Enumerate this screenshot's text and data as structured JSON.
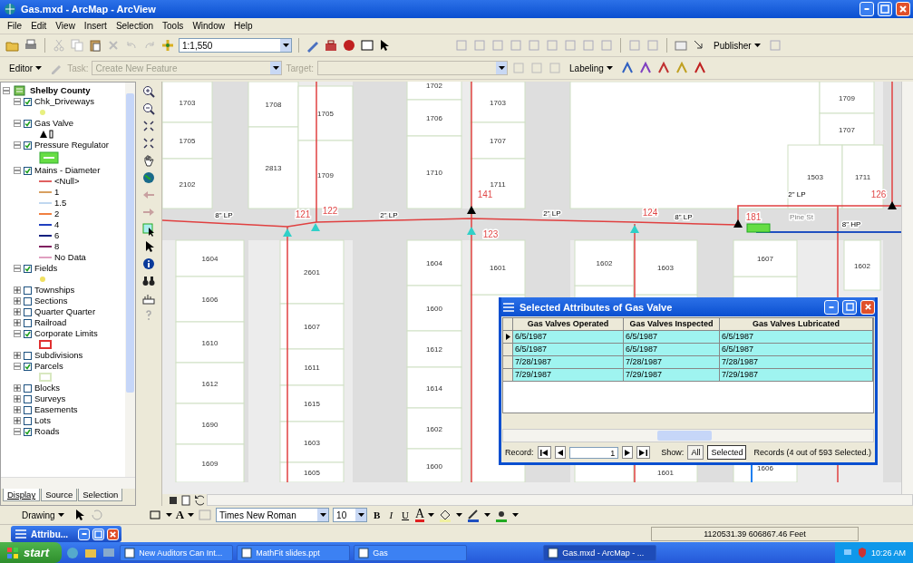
{
  "window": {
    "title": "Gas.mxd - ArcMap - ArcView"
  },
  "menu": [
    "File",
    "Edit",
    "View",
    "Insert",
    "Selection",
    "Tools",
    "Window",
    "Help"
  ],
  "standard_toolbar": {
    "scale": "1:1,550",
    "publisher": "Publisher"
  },
  "editor_toolbar": {
    "editor": "Editor",
    "task_label": "Task:",
    "task": "Create New Feature",
    "target_label": "Target:",
    "labeling": "Labeling"
  },
  "toc": {
    "root": "Shelby County",
    "root_expanded": true,
    "layers": [
      {
        "name": "Chk_Driveways",
        "checked": true,
        "expanded": true,
        "legend": [
          {
            "kind": "point",
            "color": "#e8f080"
          }
        ]
      },
      {
        "name": "Gas Valve",
        "checked": true,
        "expanded": true,
        "legend": [
          {
            "kind": "triangle",
            "color": "#000000"
          }
        ]
      },
      {
        "name": "Pressure Regulator",
        "checked": true,
        "expanded": true,
        "legend": [
          {
            "kind": "fill",
            "color": "#66dd44"
          }
        ]
      },
      {
        "name": "Mains - Diameter",
        "checked": true,
        "expanded": true,
        "legend": [
          {
            "kind": "line",
            "label": "<Null>",
            "color": "#e06060"
          },
          {
            "kind": "line",
            "label": "1",
            "color": "#d8a060"
          },
          {
            "kind": "line",
            "label": "1.5",
            "color": "#c0d8f0"
          },
          {
            "kind": "line",
            "label": "2",
            "color": "#f08040"
          },
          {
            "kind": "line",
            "label": "4",
            "color": "#2040c0"
          },
          {
            "kind": "line",
            "label": "6",
            "color": "#102080"
          },
          {
            "kind": "line",
            "label": "8",
            "color": "#802060"
          },
          {
            "kind": "line",
            "label": "No Data",
            "color": "#e0a0c0"
          }
        ]
      },
      {
        "name": "Fields",
        "checked": true,
        "expanded": true,
        "legend": [
          {
            "kind": "point",
            "color": "#f0e060"
          }
        ]
      },
      {
        "name": "Townships",
        "checked": false,
        "expanded": false
      },
      {
        "name": "Sections",
        "checked": false,
        "expanded": false
      },
      {
        "name": "Quarter Quarter",
        "checked": false,
        "expanded": false
      },
      {
        "name": "Railroad",
        "checked": false,
        "expanded": false
      },
      {
        "name": "Corporate Limits",
        "checked": true,
        "expanded": true,
        "legend": [
          {
            "kind": "outline",
            "color": "#e03030"
          }
        ]
      },
      {
        "name": "Subdivisions",
        "checked": false,
        "expanded": false
      },
      {
        "name": "Parcels",
        "checked": true,
        "expanded": true,
        "legend": [
          {
            "kind": "outline",
            "color": "#d8e8c0"
          }
        ]
      },
      {
        "name": "Blocks",
        "checked": false,
        "expanded": false
      },
      {
        "name": "Surveys",
        "checked": false,
        "expanded": false
      },
      {
        "name": "Easements",
        "checked": false,
        "expanded": false
      },
      {
        "name": "Lots",
        "checked": false,
        "expanded": false
      },
      {
        "name": "Roads",
        "checked": true,
        "expanded": true
      }
    ]
  },
  "toc_tabs": [
    {
      "label": "Display",
      "selected": true
    },
    {
      "label": "Source",
      "selected": false
    },
    {
      "label": "Selection",
      "selected": false
    }
  ],
  "map": {
    "parcels": [
      {
        "label": "1703"
      },
      {
        "label": "1705"
      },
      {
        "label": "2102"
      },
      {
        "label": "1708"
      },
      {
        "label": "2813"
      },
      {
        "label": "1705"
      },
      {
        "label": "1709"
      },
      {
        "label": "1702"
      },
      {
        "label": "1706"
      },
      {
        "label": "1710"
      },
      {
        "label": "1703"
      },
      {
        "label": "1707"
      },
      {
        "label": "1711"
      },
      {
        "label": "1709"
      },
      {
        "label": "1707"
      },
      {
        "label": "1503"
      },
      {
        "label": "1711"
      },
      {
        "label": "1604"
      },
      {
        "label": "1606"
      },
      {
        "label": "1610"
      },
      {
        "label": "1612"
      },
      {
        "label": "1690"
      },
      {
        "label": "1609"
      },
      {
        "label": "2601"
      },
      {
        "label": "1607"
      },
      {
        "label": "1611"
      },
      {
        "label": "1615"
      },
      {
        "label": "1603"
      },
      {
        "label": "1605"
      },
      {
        "label": "1604"
      },
      {
        "label": "1600"
      },
      {
        "label": "1612"
      },
      {
        "label": "1614"
      },
      {
        "label": "1602"
      },
      {
        "label": "1600"
      },
      {
        "label": "1601"
      },
      {
        "label": "1602"
      },
      {
        "label": "1603"
      },
      {
        "label": "1607"
      },
      {
        "label": "1602"
      },
      {
        "label": "1606"
      },
      {
        "label": "1601"
      }
    ],
    "labels": [
      {
        "text": "8\" LP",
        "kind": "pipe"
      },
      {
        "text": "121",
        "kind": "valve"
      },
      {
        "text": "122",
        "kind": "valve"
      },
      {
        "text": "2\" LP",
        "kind": "pipe"
      },
      {
        "text": "141",
        "kind": "valve"
      },
      {
        "text": "123",
        "kind": "valve"
      },
      {
        "text": "2\" LP",
        "kind": "pipe"
      },
      {
        "text": "124",
        "kind": "valve"
      },
      {
        "text": "8\" LP",
        "kind": "pipe"
      },
      {
        "text": "181",
        "kind": "valve"
      },
      {
        "text": "2\" LP",
        "kind": "pipe"
      },
      {
        "text": "126",
        "kind": "valve"
      },
      {
        "text": "Pine St",
        "kind": "street"
      },
      {
        "text": "8\" HP",
        "kind": "pipe"
      }
    ],
    "valves": [
      {
        "selected": true
      },
      {
        "selected": true
      },
      {
        "selected": true
      },
      {
        "selected": true
      },
      {
        "selected": false
      },
      {
        "selected": false
      },
      {
        "selected": false
      }
    ]
  },
  "attributes": {
    "title": "Selected Attributes of Gas Valve",
    "columns": [
      "Gas Valves Operated",
      "Gas Valves Inspected",
      "Gas Valves Lubricated"
    ],
    "rows": [
      {
        "cells": [
          "6/5/1987",
          "6/5/1987",
          "6/5/1987"
        ],
        "selected": true,
        "current": true
      },
      {
        "cells": [
          "6/5/1987",
          "6/5/1987",
          "6/5/1987"
        ],
        "selected": true,
        "current": false
      },
      {
        "cells": [
          "7/28/1987",
          "7/28/1987",
          "7/28/1987"
        ],
        "selected": true,
        "current": false
      },
      {
        "cells": [
          "7/29/1987",
          "7/29/1987",
          "7/29/1987"
        ],
        "selected": true,
        "current": false
      }
    ],
    "record_label": "Record:",
    "record": "1",
    "show_label": "Show:",
    "show": [
      {
        "label": "All",
        "selected": false
      },
      {
        "label": "Selected",
        "selected": true
      }
    ],
    "summary": "Records (4 out of 593 Selected.)"
  },
  "drawing_toolbar": {
    "drawing": "Drawing",
    "text_tool": "A",
    "font": "Times New Roman",
    "size": "10",
    "styles": [
      "B",
      "I",
      "U"
    ],
    "font_color": "A"
  },
  "minimized_window": {
    "title": "Attribu..."
  },
  "status_bar": {
    "coordinates": "1120531.39  606867.46 Feet"
  },
  "taskbar": {
    "start": "start",
    "tasks": [
      {
        "label": "New Auditors Can Int...",
        "selected": false
      },
      {
        "label": "MathFit slides.ppt",
        "selected": false
      },
      {
        "label": "Gas",
        "selected": false
      },
      {
        "label": "Gas.mxd - ArcMap - ...",
        "selected": true
      }
    ],
    "clock": "10:26 AM"
  }
}
